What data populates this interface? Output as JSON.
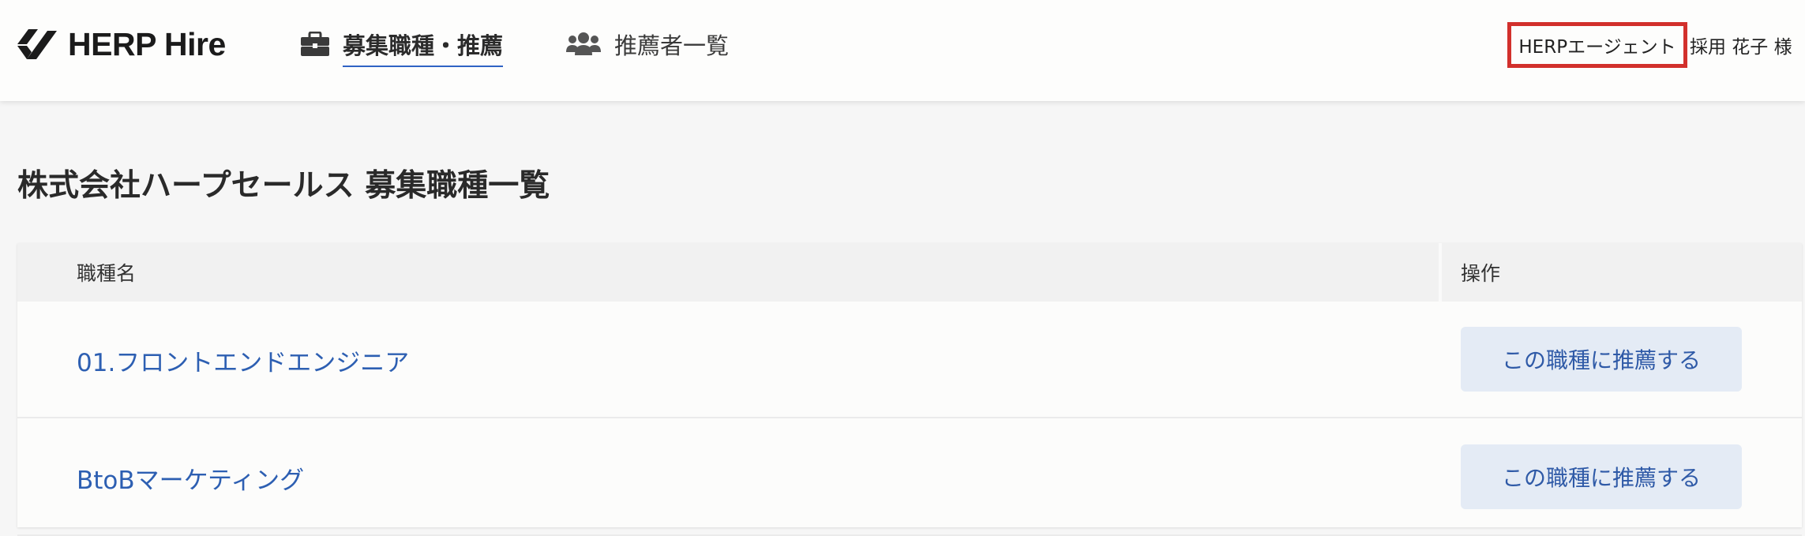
{
  "header": {
    "brand": "HERP Hire",
    "nav": [
      {
        "label": "募集職種・推薦",
        "icon": "briefcase-icon",
        "active": true
      },
      {
        "label": "推薦者一覧",
        "icon": "users-icon",
        "active": false
      }
    ],
    "agent_name": "HERPエージェント",
    "user_name": "採用 花子 様"
  },
  "page": {
    "title": "株式会社ハープセールス 募集職種一覧"
  },
  "table": {
    "columns": [
      "職種名",
      "操作"
    ],
    "rows": [
      {
        "job": "01.フロントエンドエンジニア",
        "action": "この職種に推薦する"
      },
      {
        "job": "BtoBマーケティング",
        "action": "この職種に推薦する"
      }
    ]
  },
  "colors": {
    "accent": "#2f63c4",
    "link": "#2d5fb2",
    "highlight_border": "#d2302c",
    "button_bg": "#e4ebf5"
  }
}
